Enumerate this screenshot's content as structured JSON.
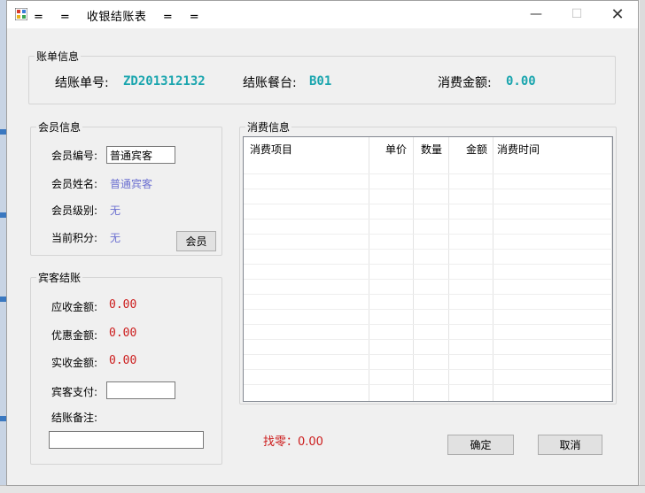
{
  "window": {
    "title": "=    =    收银结账表    =    ="
  },
  "controls": {
    "minimize": "—",
    "maximize": "☐",
    "close": "✕"
  },
  "bill_info": {
    "group_title": "账单信息",
    "bill_no_label": "结账单号:",
    "bill_no": "ZD201312132",
    "table_label": "结账餐台:",
    "table_no": "B01",
    "amount_label": "消费金额:",
    "amount": "0.00"
  },
  "member_info": {
    "group_title": "会员信息",
    "id_label": "会员编号:",
    "id_value": "普通宾客",
    "name_label": "会员姓名:",
    "name_value": "普通宾客",
    "level_label": "会员级别:",
    "level_value": "无",
    "points_label": "当前积分:",
    "points_value": "无",
    "member_button": "会员"
  },
  "checkout": {
    "group_title": "宾客结账",
    "receivable_label": "应收金额:",
    "receivable": "0.00",
    "discount_label": "优惠金额:",
    "discount": "0.00",
    "received_label": "实收金额:",
    "received": "0.00",
    "paid_label": "宾客支付:",
    "paid_value": "",
    "remark_label": "结账备注:",
    "remark_value": ""
  },
  "consumption": {
    "group_title": "消费信息",
    "columns": [
      "消费项目",
      "单价",
      "数量",
      "金额",
      "消费时间"
    ]
  },
  "footer": {
    "change": "找零：0.00",
    "confirm_button": "确定",
    "cancel_button": "取消"
  },
  "colors": {
    "accent_value": "#1aa5ae",
    "member_value": "#6b6fd0",
    "money_value": "#cc1c1c"
  }
}
